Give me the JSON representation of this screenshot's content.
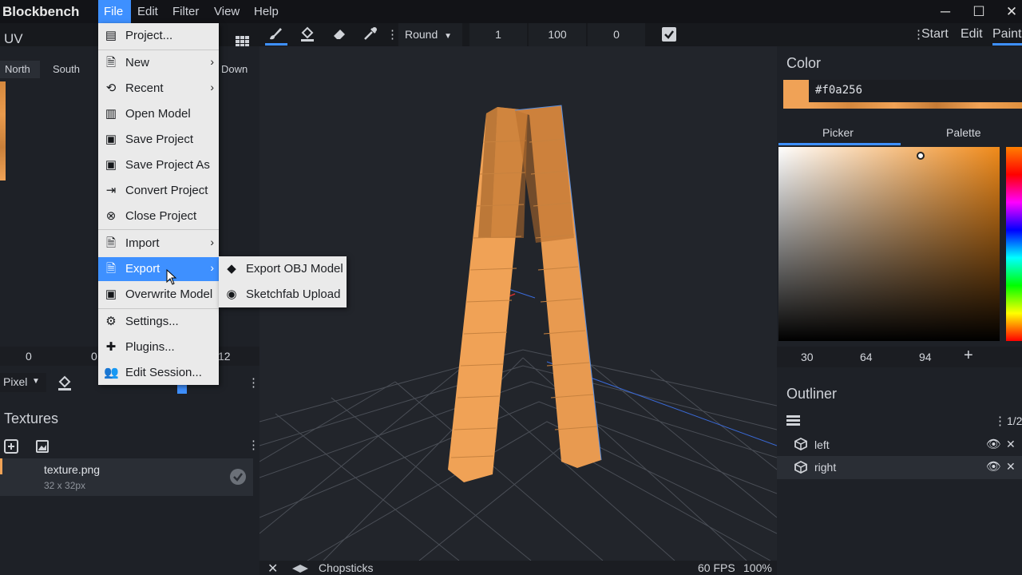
{
  "app": {
    "title": "Blockbench"
  },
  "menubar": {
    "items": [
      "File",
      "Edit",
      "Filter",
      "View",
      "Help"
    ]
  },
  "window": {
    "minimize": "─",
    "maximize": "☐",
    "close": "✕"
  },
  "toolbar": {
    "brush_shape": "Round",
    "values": [
      "1",
      "100",
      "0"
    ],
    "modes": [
      "Start",
      "Edit",
      "Paint"
    ]
  },
  "uv_panel": {
    "title": "UV",
    "faces": [
      "North",
      "South",
      "Down"
    ],
    "coords": [
      "0",
      "0",
      "12"
    ],
    "mode": "Pixel"
  },
  "textures": {
    "title": "Textures",
    "items": [
      {
        "name": "texture.png",
        "size": "32 x 32px"
      }
    ]
  },
  "viewport": {
    "model_name": "Chopsticks",
    "fps": "60 FPS",
    "zoom": "100%"
  },
  "color_panel": {
    "title": "Color",
    "hex": "#f0a256",
    "tabs": [
      "Picker",
      "Palette"
    ],
    "hsv": [
      "30",
      "64",
      "94"
    ],
    "add": "+"
  },
  "outliner": {
    "title": "Outliner",
    "count": "1/2",
    "items": [
      "left",
      "right"
    ]
  },
  "file_menu": {
    "items": [
      {
        "label": "Project...",
        "icon": "project-icon"
      },
      {
        "label": "New",
        "icon": "new-file-icon",
        "submenu": true
      },
      {
        "label": "Recent",
        "icon": "history-icon",
        "submenu": true
      },
      {
        "label": "Open Model",
        "icon": "open-model-icon"
      },
      {
        "label": "Save Project",
        "icon": "save-icon"
      },
      {
        "label": "Save Project As",
        "icon": "save-as-icon"
      },
      {
        "label": "Convert Project",
        "icon": "convert-icon"
      },
      {
        "label": "Close Project",
        "icon": "close-circle-icon"
      },
      {
        "label": "Import",
        "icon": "import-icon",
        "submenu": true
      },
      {
        "label": "Export",
        "icon": "export-icon",
        "submenu": true
      },
      {
        "label": "Overwrite Model",
        "icon": "overwrite-icon"
      },
      {
        "label": "Settings...",
        "icon": "gear-icon"
      },
      {
        "label": "Plugins...",
        "icon": "puzzle-icon"
      },
      {
        "label": "Edit Session...",
        "icon": "users-icon"
      }
    ],
    "export_submenu": [
      {
        "label": "Export OBJ Model",
        "icon": "obj-icon"
      },
      {
        "label": "Sketchfab Upload",
        "icon": "sketchfab-icon"
      }
    ]
  },
  "colors": {
    "accent": "#3e90ff",
    "model_orange": "#f0a256",
    "menu_bg": "#eaeaea",
    "panel_bg": "#1e2127"
  }
}
